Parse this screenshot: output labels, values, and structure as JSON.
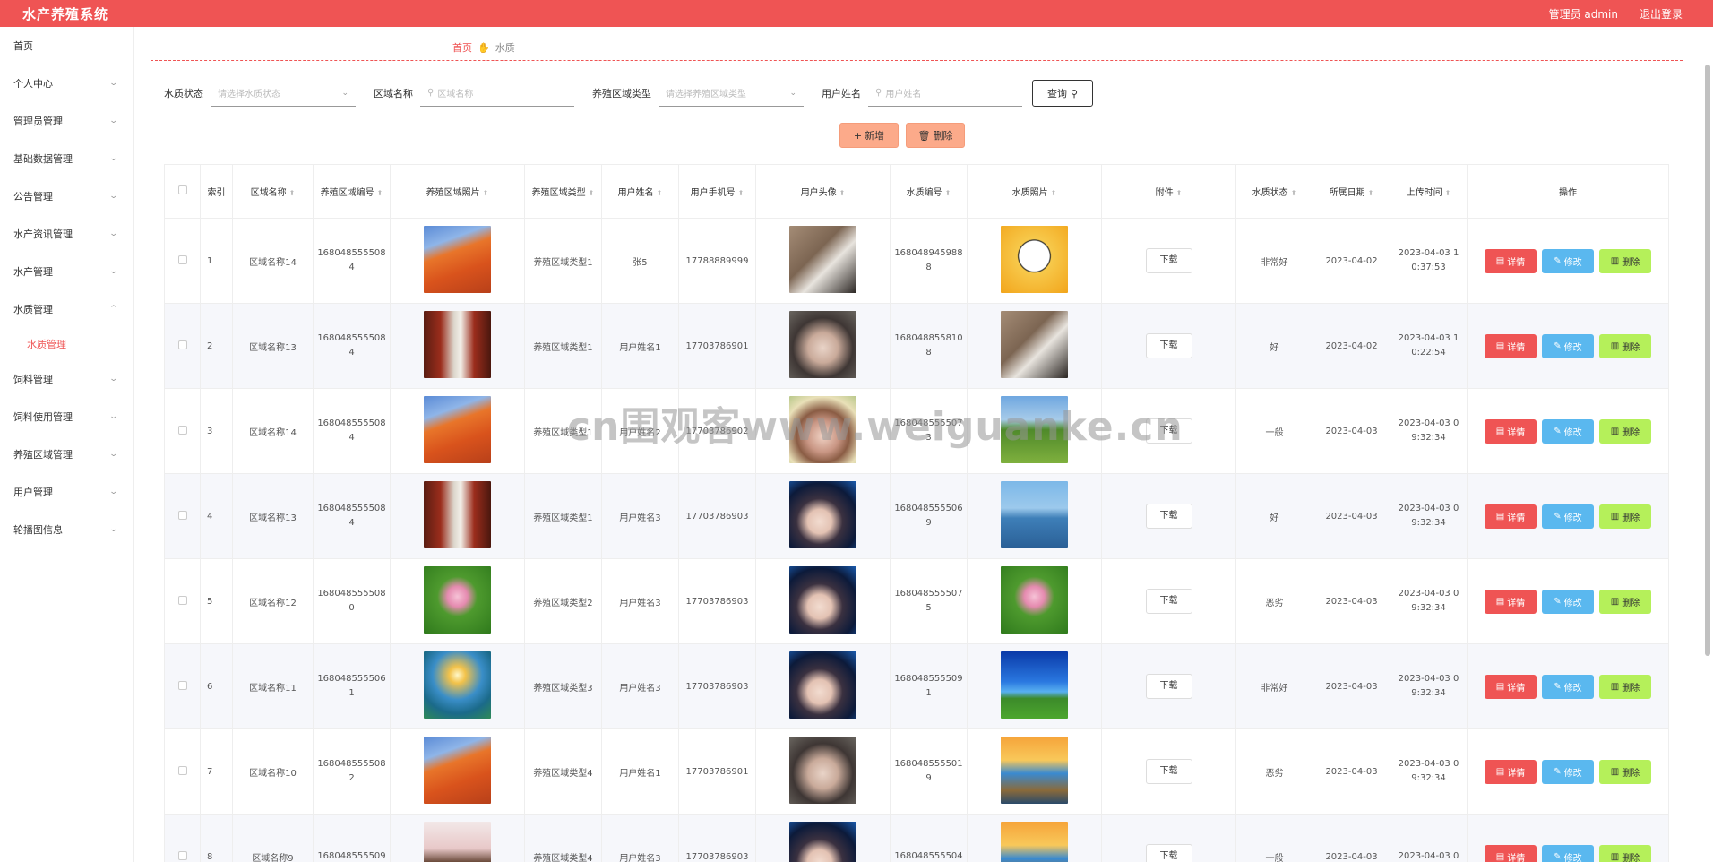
{
  "app": {
    "title": "水产养殖系统",
    "user_label": "管理员 admin",
    "logout": "退出登录"
  },
  "sidebar": {
    "items": [
      {
        "label": "首页",
        "expandable": false
      },
      {
        "label": "个人中心",
        "expandable": true
      },
      {
        "label": "管理员管理",
        "expandable": true
      },
      {
        "label": "基础数据管理",
        "expandable": true
      },
      {
        "label": "公告管理",
        "expandable": true
      },
      {
        "label": "水产资讯管理",
        "expandable": true
      },
      {
        "label": "水产管理",
        "expandable": true
      },
      {
        "label": "水质管理",
        "expandable": true,
        "open": true
      },
      {
        "label": "饲料管理",
        "expandable": true
      },
      {
        "label": "饲料使用管理",
        "expandable": true
      },
      {
        "label": "养殖区域管理",
        "expandable": true
      },
      {
        "label": "用户管理",
        "expandable": true
      },
      {
        "label": "轮播图信息",
        "expandable": true
      }
    ],
    "active_sub": "水质管理"
  },
  "breadcrumb": {
    "home": "首页",
    "current": "水质"
  },
  "search": {
    "status_label": "水质状态",
    "status_placeholder": "请选择水质状态",
    "area_label": "区域名称",
    "area_placeholder": "区域名称",
    "type_label": "养殖区域类型",
    "type_placeholder": "请选择养殖区域类型",
    "user_label": "用户姓名",
    "user_placeholder": "用户姓名",
    "query_button": "查询"
  },
  "actions": {
    "add": "新增",
    "delete": "删除"
  },
  "table": {
    "headers": [
      "索引",
      "区域名称",
      "养殖区域编号",
      "养殖区域照片",
      "养殖区域类型",
      "用户姓名",
      "用户手机号",
      "用户头像",
      "水质编号",
      "水质照片",
      "附件",
      "水质状态",
      "所属日期",
      "上传时间",
      "操作"
    ],
    "row_buttons": {
      "download": "下载",
      "detail": "详情",
      "edit": "修改",
      "delete": "删除"
    },
    "rows": [
      {
        "index": "1",
        "area": "区域名称14",
        "area_no": "1680485555084",
        "area_photo": "orange-mountain",
        "type": "养殖区域类型1",
        "user": "张5",
        "phone": "17788889999",
        "avatar": "gallery-person",
        "wq_no": "1680489459888",
        "wq_photo": "cartoon-boy",
        "status": "非常好",
        "date": "2023-04-02",
        "upload": "2023-04-03 10:37:53"
      },
      {
        "index": "2",
        "area": "区域名称13",
        "area_no": "1680485555084",
        "area_photo": "red-corridor",
        "type": "养殖区域类型1",
        "user": "用户姓名1",
        "phone": "17703786901",
        "avatar": "girl-portrait",
        "wq_no": "1680488558108",
        "wq_photo": "gallery-person",
        "status": "好",
        "date": "2023-04-02",
        "upload": "2023-04-03 10:22:54"
      },
      {
        "index": "3",
        "area": "区域名称14",
        "area_no": "1680485555084",
        "area_photo": "orange-mountain",
        "type": "养殖区域类型1",
        "user": "用户姓名2",
        "phone": "17703786902",
        "avatar": "girl-flowers",
        "wq_no": "1680485555073",
        "wq_photo": "green-meadow",
        "status": "一般",
        "date": "2023-04-03",
        "upload": "2023-04-03 09:32:34"
      },
      {
        "index": "4",
        "area": "区域名称13",
        "area_no": "1680485555084",
        "area_photo": "red-corridor",
        "type": "养殖区域类型1",
        "user": "用户姓名3",
        "phone": "17703786903",
        "avatar": "boy-portrait",
        "wq_no": "1680485555069",
        "wq_photo": "blue-lake",
        "status": "好",
        "date": "2023-04-03",
        "upload": "2023-04-03 09:32:34"
      },
      {
        "index": "5",
        "area": "区域名称12",
        "area_no": "1680485555080",
        "area_photo": "lotus",
        "type": "养殖区域类型2",
        "user": "用户姓名3",
        "phone": "17703786903",
        "avatar": "boy-portrait",
        "wq_no": "1680485555075",
        "wq_photo": "lotus",
        "status": "恶劣",
        "date": "2023-04-03",
        "upload": "2023-04-03 09:32:34"
      },
      {
        "index": "6",
        "area": "区域名称11",
        "area_no": "1680485555061",
        "area_photo": "sunset-lake",
        "type": "养殖区域类型3",
        "user": "用户姓名3",
        "phone": "17703786903",
        "avatar": "boy-portrait",
        "wq_no": "1680485555091",
        "wq_photo": "blue-sky-field",
        "status": "非常好",
        "date": "2023-04-03",
        "upload": "2023-04-03 09:32:34"
      },
      {
        "index": "7",
        "area": "区域名称10",
        "area_no": "1680485555082",
        "area_photo": "orange-mountain",
        "type": "养殖区域类型4",
        "user": "用户姓名1",
        "phone": "17703786901",
        "avatar": "girl-portrait",
        "wq_no": "1680485555019",
        "wq_photo": "sunset-beach",
        "status": "恶劣",
        "date": "2023-04-03",
        "upload": "2023-04-03 09:32:34"
      },
      {
        "index": "8",
        "area": "区域名称9",
        "area_no": "168048555509",
        "area_photo": "blossom-tree",
        "type": "养殖区域类型4",
        "user": "用户姓名3",
        "phone": "17703786903",
        "avatar": "boy-portrait",
        "wq_no": "168048555504",
        "wq_photo": "sunset-beach",
        "status": "一般",
        "date": "2023-04-03",
        "upload": "2023-04-03 0"
      }
    ]
  },
  "watermark": "cn围观客www.weiguanke.cn",
  "colors": {
    "brand": "#ef5454",
    "edit": "#5ab8ef",
    "delete": "#b5f05a",
    "add": "#fcaa8a"
  }
}
